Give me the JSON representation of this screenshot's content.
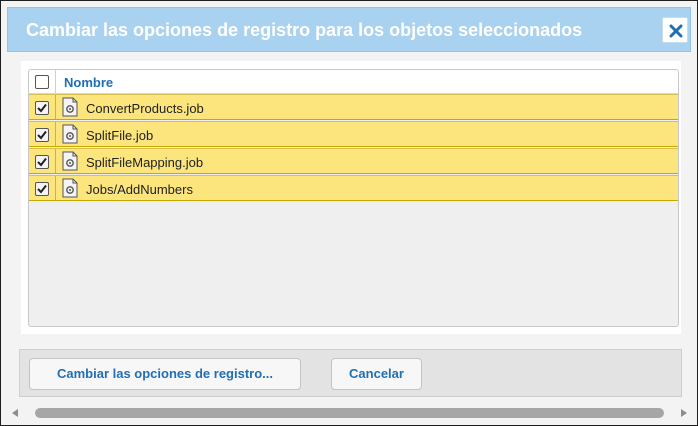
{
  "dialog": {
    "title": "Cambiar las opciones de registro para los objetos seleccionados",
    "close_icon": "close-icon"
  },
  "list": {
    "header": {
      "name_label": "Nombre",
      "select_all_checked": false
    },
    "rows": [
      {
        "label": "ConvertProducts.job",
        "checked": true,
        "icon": "job-file-icon"
      },
      {
        "label": "SplitFile.job",
        "checked": true,
        "icon": "job-file-icon"
      },
      {
        "label": "SplitFileMapping.job",
        "checked": true,
        "icon": "job-file-icon"
      },
      {
        "label": "Jobs/AddNumbers",
        "checked": true,
        "icon": "job-file-icon"
      }
    ]
  },
  "footer": {
    "change_label": "Cambiar las opciones de registro...",
    "cancel_label": "Cancelar"
  },
  "colors": {
    "titlebar": "#a9d1f0",
    "row_highlight": "#fbe57c",
    "link_blue": "#1f6fb5"
  }
}
